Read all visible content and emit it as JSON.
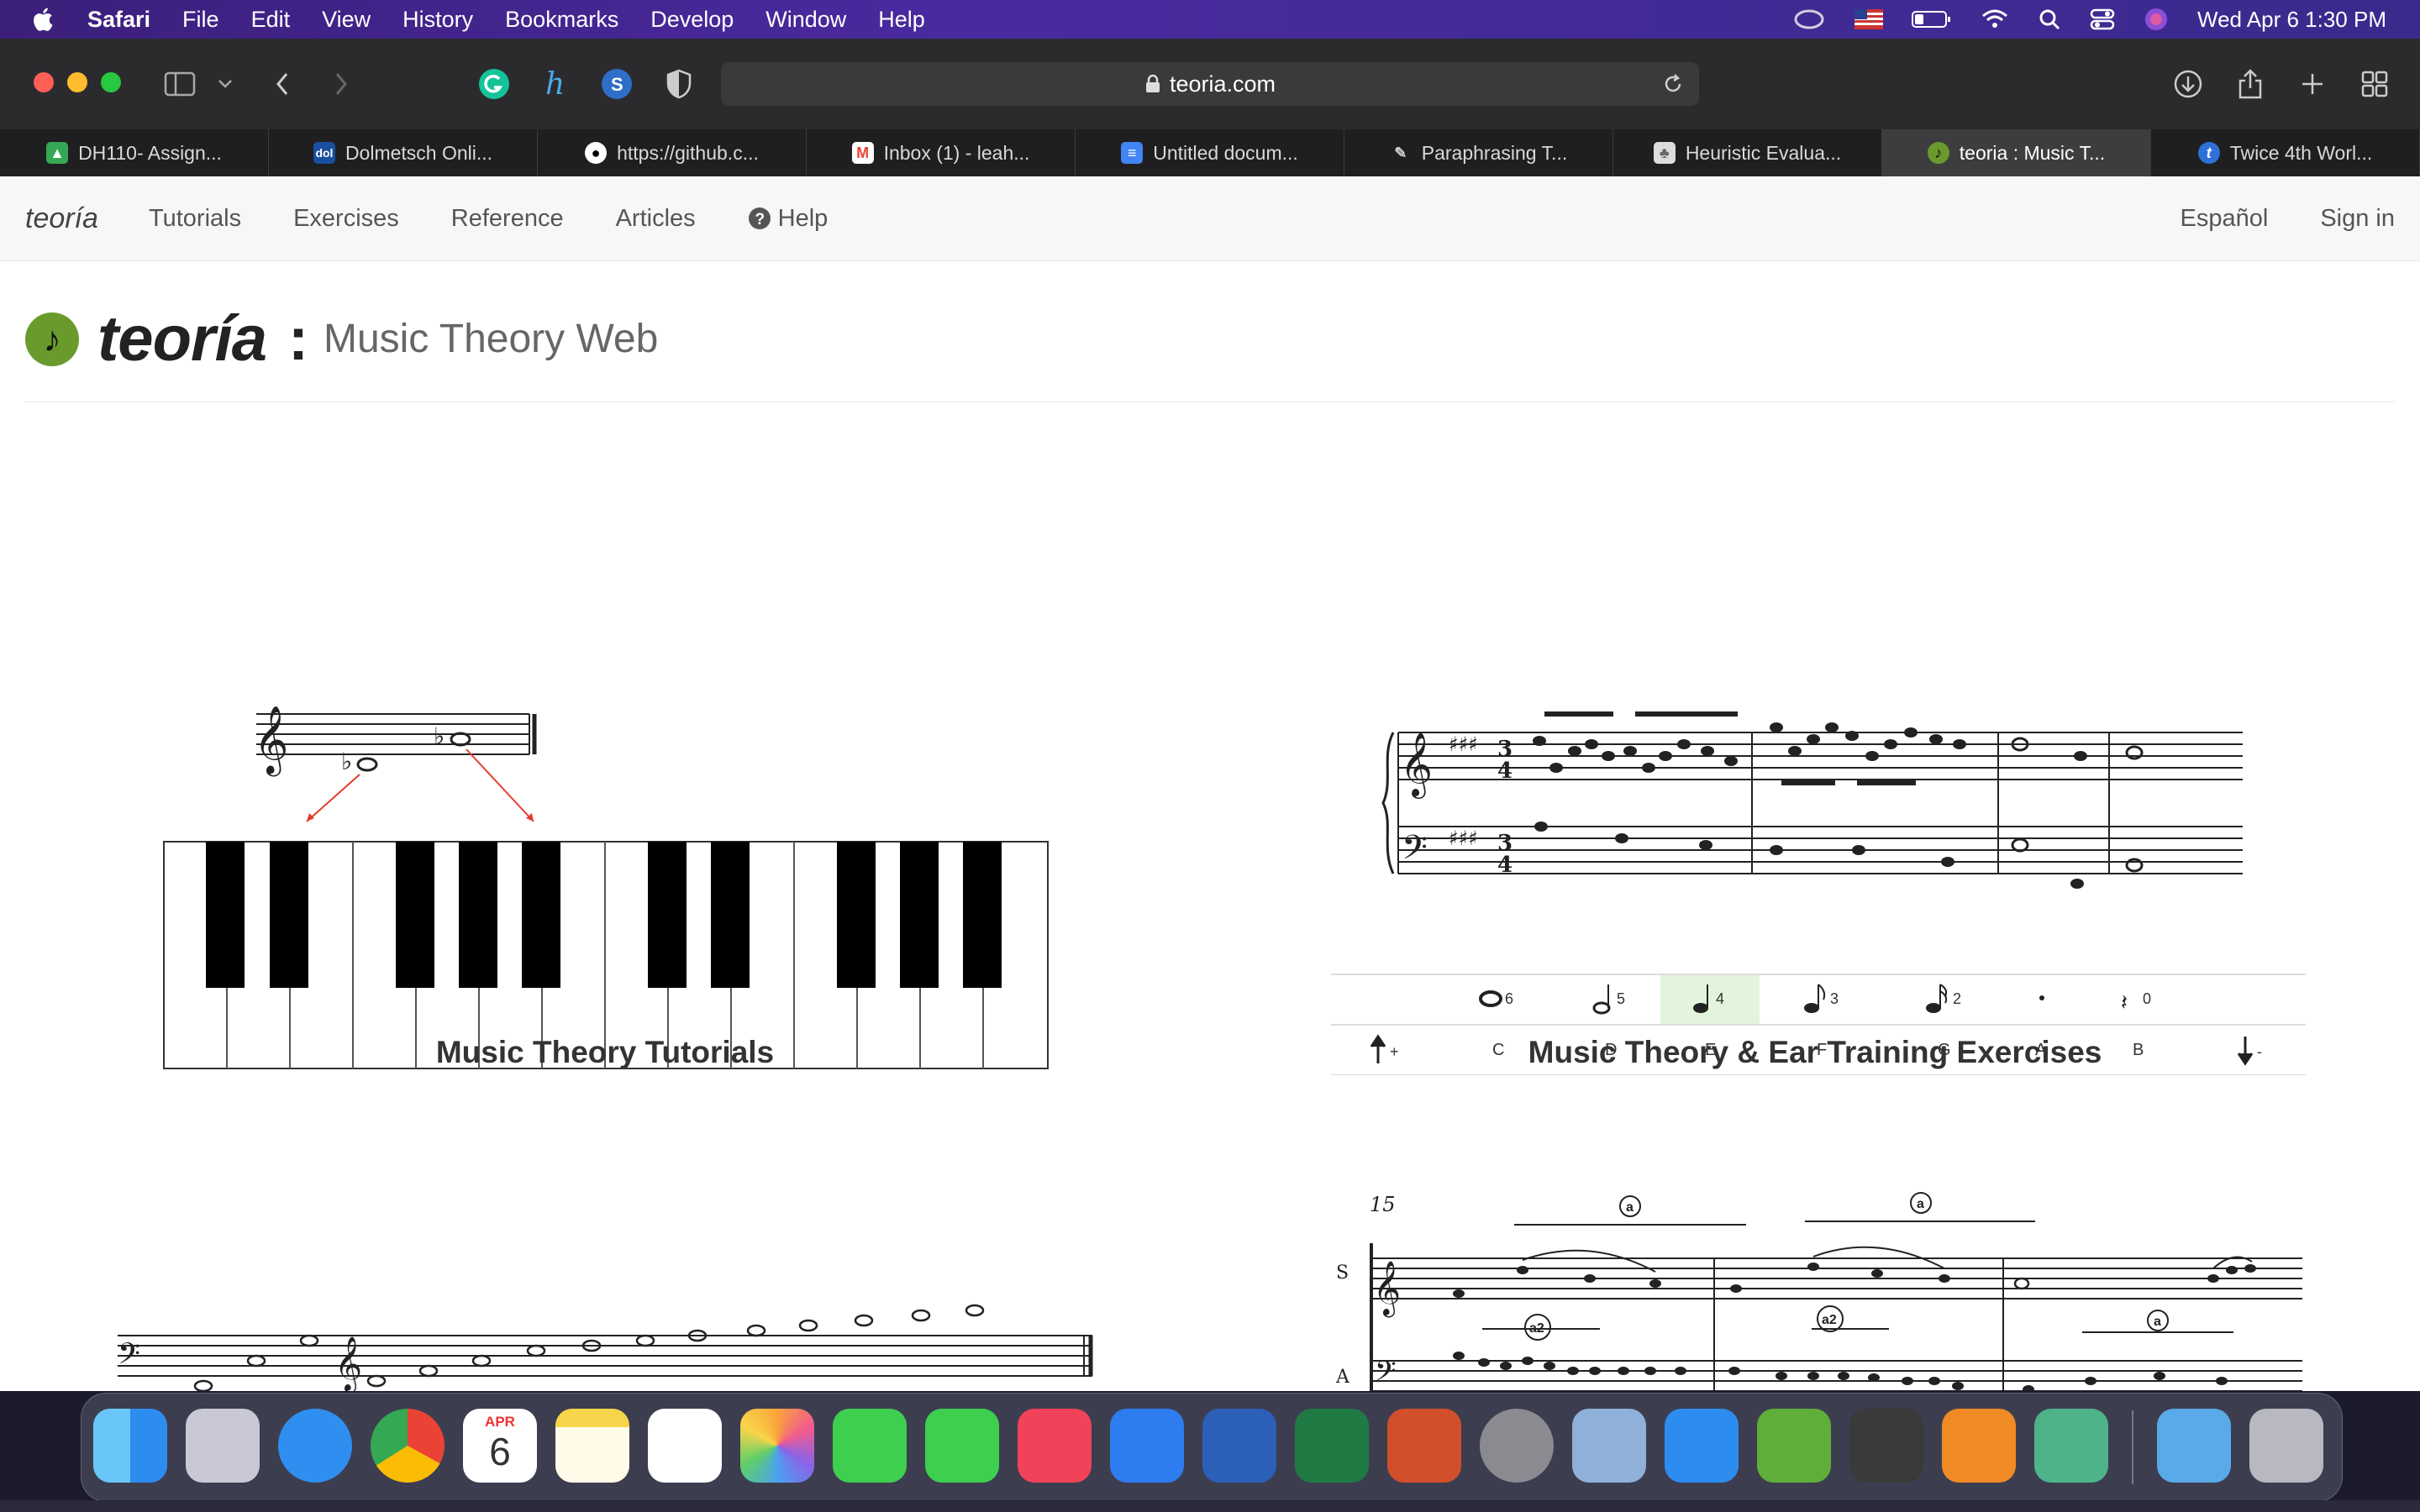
{
  "menubar": {
    "app": "Safari",
    "items": [
      "File",
      "Edit",
      "View",
      "History",
      "Bookmarks",
      "Develop",
      "Window",
      "Help"
    ],
    "clock": "Wed Apr 6  1:30 PM"
  },
  "browser": {
    "url": "teoria.com",
    "tabs": [
      {
        "label": "DH110- Assign...",
        "icon": "google-drive-icon",
        "color": "#34a853"
      },
      {
        "label": "Dolmetsch Onli...",
        "icon": "dolmetsch-icon",
        "color": "#1a4fa0"
      },
      {
        "label": "https://github.c...",
        "icon": "github-icon",
        "color": "#ffffff"
      },
      {
        "label": "Inbox (1) - leah...",
        "icon": "gmail-icon",
        "color": "#ea4335"
      },
      {
        "label": "Untitled docum...",
        "icon": "google-docs-icon",
        "color": "#4285f4"
      },
      {
        "label": "Paraphrasing T...",
        "icon": "quill-icon",
        "color": "#cccccc"
      },
      {
        "label": "Heuristic Evalua...",
        "icon": "tree-icon",
        "color": "#888888"
      },
      {
        "label": "teoria : Music T...",
        "icon": "teoria-icon",
        "color": "#6a9a2c",
        "active": true
      },
      {
        "label": "Twice 4th Worl...",
        "icon": "t-icon",
        "color": "#2e6fd8"
      }
    ]
  },
  "site": {
    "brand": "teoría",
    "nav": [
      "Tutorials",
      "Exercises",
      "Reference",
      "Articles",
      "Help"
    ],
    "nav_right": [
      "Español",
      "Sign in"
    ],
    "title": "teoría",
    "colon": ":",
    "subtitle": "Music Theory Web",
    "captions": {
      "tutorials": "Music Theory Tutorials",
      "exercises": "Music Theory & Ear Training Exercises"
    },
    "exercise_panel": {
      "durations": [
        "6",
        "5",
        "4",
        "3",
        "2",
        "0"
      ],
      "notes": [
        "C",
        "D",
        "E",
        "F",
        "G",
        "A",
        "B"
      ],
      "up": "+",
      "down": "-",
      "highlight": "#e2f5dc"
    },
    "score_labels": {
      "measure": "15",
      "s": "S",
      "a": "A",
      "marks": [
        "a",
        "a",
        "a2",
        "a2",
        "a"
      ]
    }
  },
  "dock": {
    "apps": [
      {
        "name": "finder-icon",
        "color": "#2d8cf0"
      },
      {
        "name": "launchpad-icon",
        "color": "#c9c9d6"
      },
      {
        "name": "safari-icon",
        "color": "#2f8ff0"
      },
      {
        "name": "chrome-icon",
        "color": "#ffffff"
      },
      {
        "name": "calendar-icon",
        "color": "#ffffff"
      },
      {
        "name": "notes-icon",
        "color": "#f7d54a"
      },
      {
        "name": "reminders-icon",
        "color": "#ffffff"
      },
      {
        "name": "photos-icon",
        "color": "#ffffff"
      },
      {
        "name": "messages-icon",
        "color": "#3ecf4f"
      },
      {
        "name": "facetime-icon",
        "color": "#3ecf4f"
      },
      {
        "name": "music-icon",
        "color": "#f0435a"
      },
      {
        "name": "app-store-icon",
        "color": "#2d7cf0"
      },
      {
        "name": "word-icon",
        "color": "#2b5fb8"
      },
      {
        "name": "excel-icon",
        "color": "#1f7a44"
      },
      {
        "name": "powerpoint-icon",
        "color": "#d14f2b"
      },
      {
        "name": "system-preferences-icon",
        "color": "#8a8a90"
      },
      {
        "name": "preview-icon",
        "color": "#8fb0d8"
      },
      {
        "name": "zoom-icon",
        "color": "#2d8cf0"
      },
      {
        "name": "cloud-app-icon",
        "color": "#5fae3a"
      },
      {
        "name": "calculator-icon",
        "color": "#3a3a3a"
      },
      {
        "name": "books-icon",
        "color": "#f08a24"
      },
      {
        "name": "atom-icon",
        "color": "#4fb38a"
      },
      {
        "name": "downloads-folder-icon",
        "color": "#5aa9e8"
      },
      {
        "name": "trash-icon",
        "color": "#b8b8c0"
      }
    ],
    "calendar": {
      "month": "APR",
      "day": "6"
    }
  }
}
